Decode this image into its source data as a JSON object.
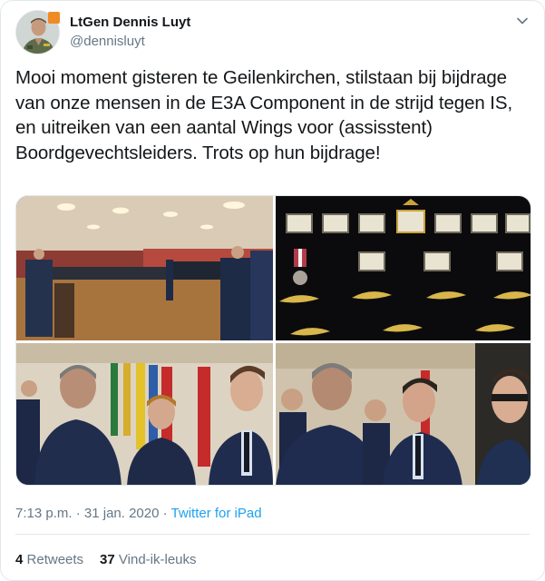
{
  "author": {
    "display_name": "LtGen Dennis Luyt",
    "handle": "@dennisluyt",
    "avatar_icon": "profile-photo-icon",
    "badge_color": "#f08a24"
  },
  "tweet": {
    "text": "Mooi moment gisteren te Geilenkirchen, stilstaan bij bijdrage van onze mensen in de E3A Component in de strijd tegen IS, en uitreiken van een aantal Wings voor (assisstent) Boordgevechtsleiders. Trots op hun bijdrage!",
    "time": "7:13 p.m.",
    "separator": "·",
    "date": "31 jan. 2020",
    "source": "Twitter for iPad"
  },
  "stats": {
    "retweets_count": "4",
    "retweets_label": "Retweets",
    "likes_count": "37",
    "likes_label": "Vind-ik-leuks"
  },
  "colors": {
    "text": "#14171a",
    "secondary": "#657786",
    "link": "#1da1f2",
    "border": "#e1e8ed"
  },
  "icons": {
    "menu": "chevron-down-icon"
  }
}
